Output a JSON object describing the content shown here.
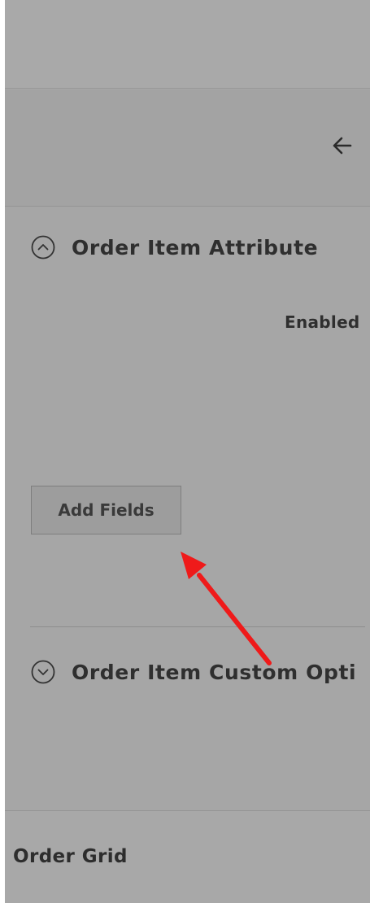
{
  "header": {
    "back_icon": "arrow-left-icon"
  },
  "sections": {
    "order_item_attribute": {
      "title": "Order Item Attribute",
      "state": "expanded",
      "icon": "chevron-up-circle-icon"
    },
    "order_item_custom_options": {
      "title": "Order Item Custom Opti",
      "state": "collapsed",
      "icon": "chevron-down-circle-icon"
    }
  },
  "fields": {
    "enabled_label": "Enabled"
  },
  "buttons": {
    "add_fields_label": "Add Fields"
  },
  "footer": {
    "order_grid_label": "Order Grid"
  },
  "annotation": {
    "type": "arrow",
    "color": "#ef1a1a",
    "points_to": "add-fields-button"
  },
  "colors": {
    "overlay": "#a7a7a7",
    "text": "#2f2f2f",
    "button_bg": "#9d9d9d"
  }
}
